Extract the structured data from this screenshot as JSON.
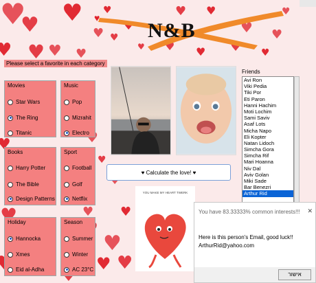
{
  "prompt": "Please select a favorite in each category",
  "logo_text": "N&B",
  "groups": {
    "movies": {
      "title": "Movies",
      "options": [
        "Star Wars",
        "The Ring",
        "Titanic"
      ],
      "selected": 1
    },
    "music": {
      "title": "Music",
      "options": [
        "Pop",
        "Mizrahit",
        "Electro"
      ],
      "selected": 2
    },
    "books": {
      "title": "Books",
      "options": [
        "Harry Potter",
        "The Bible",
        "Design Patterns"
      ],
      "selected": 2
    },
    "sport": {
      "title": "Sport",
      "options": [
        "Football",
        "Golf",
        "Netflix"
      ],
      "selected": 2
    },
    "holiday": {
      "title": "Holiday",
      "options": [
        "Hannocka",
        "Xmes",
        "Eid al-Adha"
      ],
      "selected": 0
    },
    "season": {
      "title": "Season",
      "options": [
        "Summer",
        "Winter",
        "AC 23°C"
      ],
      "selected": 2
    }
  },
  "friends": {
    "label": "Friends",
    "items": [
      "Avi Ron",
      "Viki Pedia",
      "Tiki Por",
      "Eti Paron",
      "Hanni Hachim",
      "Moti Lochim",
      "Sami Saviv",
      "Asaf Lots",
      "Micha Napo",
      "Eli Kopter",
      "Natan Lidoch",
      "Simcha Gora",
      "Simcha Rif",
      "Mari Hoanna",
      "Niv Dal",
      "Aviv Golan",
      "Miki Sade",
      "Bar Benezri",
      "Arthur Rid"
    ],
    "selected_index": 18
  },
  "calc_button": "♥ Calculate the love! ♥",
  "card_caption": "YOU MAKE MY HEART TWERK",
  "popup": {
    "title": "You have 83.33333% common interests!!!",
    "close": "✕",
    "line1": "Here is this person's Email, good luck!!",
    "line2": "ArthurRid@yahoo.com",
    "ok": "אישור"
  }
}
